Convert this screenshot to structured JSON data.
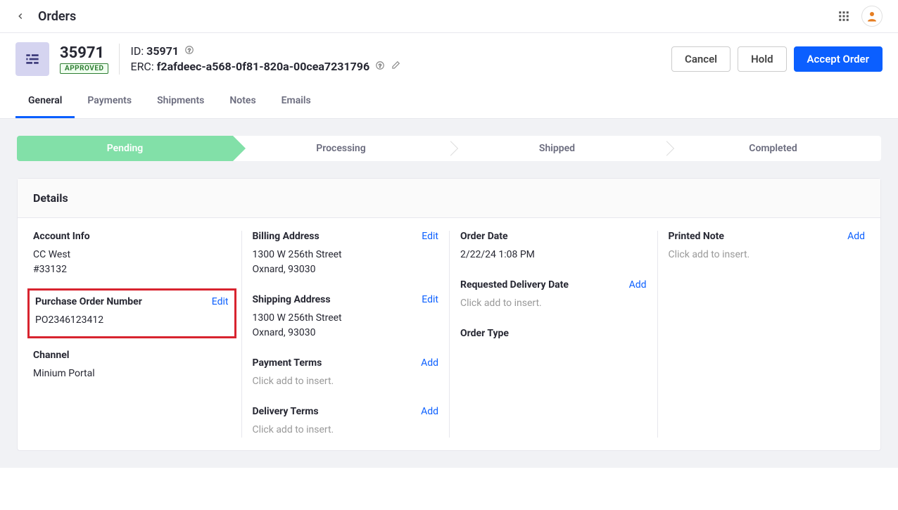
{
  "topbar": {
    "title": "Orders"
  },
  "header": {
    "orderNumber": "35971",
    "status": "APPROVED",
    "idLabel": "ID: ",
    "idValue": "35971",
    "ercLabel": "ERC: ",
    "ercValue": "f2afdeec-a568-0f81-820a-00cea7231796",
    "buttons": {
      "cancel": "Cancel",
      "hold": "Hold",
      "accept": "Accept Order"
    }
  },
  "tabs": [
    "General",
    "Payments",
    "Shipments",
    "Notes",
    "Emails"
  ],
  "steps": [
    "Pending",
    "Processing",
    "Shipped",
    "Completed"
  ],
  "panelTitle": "Details",
  "col1": {
    "accountInfoTitle": "Account Info",
    "accountName": "CC West",
    "accountId": "#33132",
    "poTitle": "Purchase Order Number",
    "poEdit": "Edit",
    "poValue": "PO2346123412",
    "channelTitle": "Channel",
    "channelValue": "Minium Portal"
  },
  "col2": {
    "billingTitle": "Billing Address",
    "billingEdit": "Edit",
    "billingLine1": "1300 W 256th Street",
    "billingLine2": "Oxnard, 93030",
    "shippingTitle": "Shipping Address",
    "shippingEdit": "Edit",
    "shippingLine1": "1300 W 256th Street",
    "shippingLine2": "Oxnard, 93030",
    "paymentTermsTitle": "Payment Terms",
    "paymentTermsAdd": "Add",
    "paymentTermsPlaceholder": "Click add to insert.",
    "deliveryTermsTitle": "Delivery Terms",
    "deliveryTermsAdd": "Add",
    "deliveryTermsPlaceholder": "Click add to insert."
  },
  "col3": {
    "orderDateTitle": "Order Date",
    "orderDateValue": "2/22/24 1:08 PM",
    "requestedTitle": "Requested Delivery Date",
    "requestedAdd": "Add",
    "requestedPlaceholder": "Click add to insert.",
    "orderTypeTitle": "Order Type"
  },
  "col4": {
    "printedNoteTitle": "Printed Note",
    "printedNoteAdd": "Add",
    "printedNotePlaceholder": "Click add to insert."
  }
}
